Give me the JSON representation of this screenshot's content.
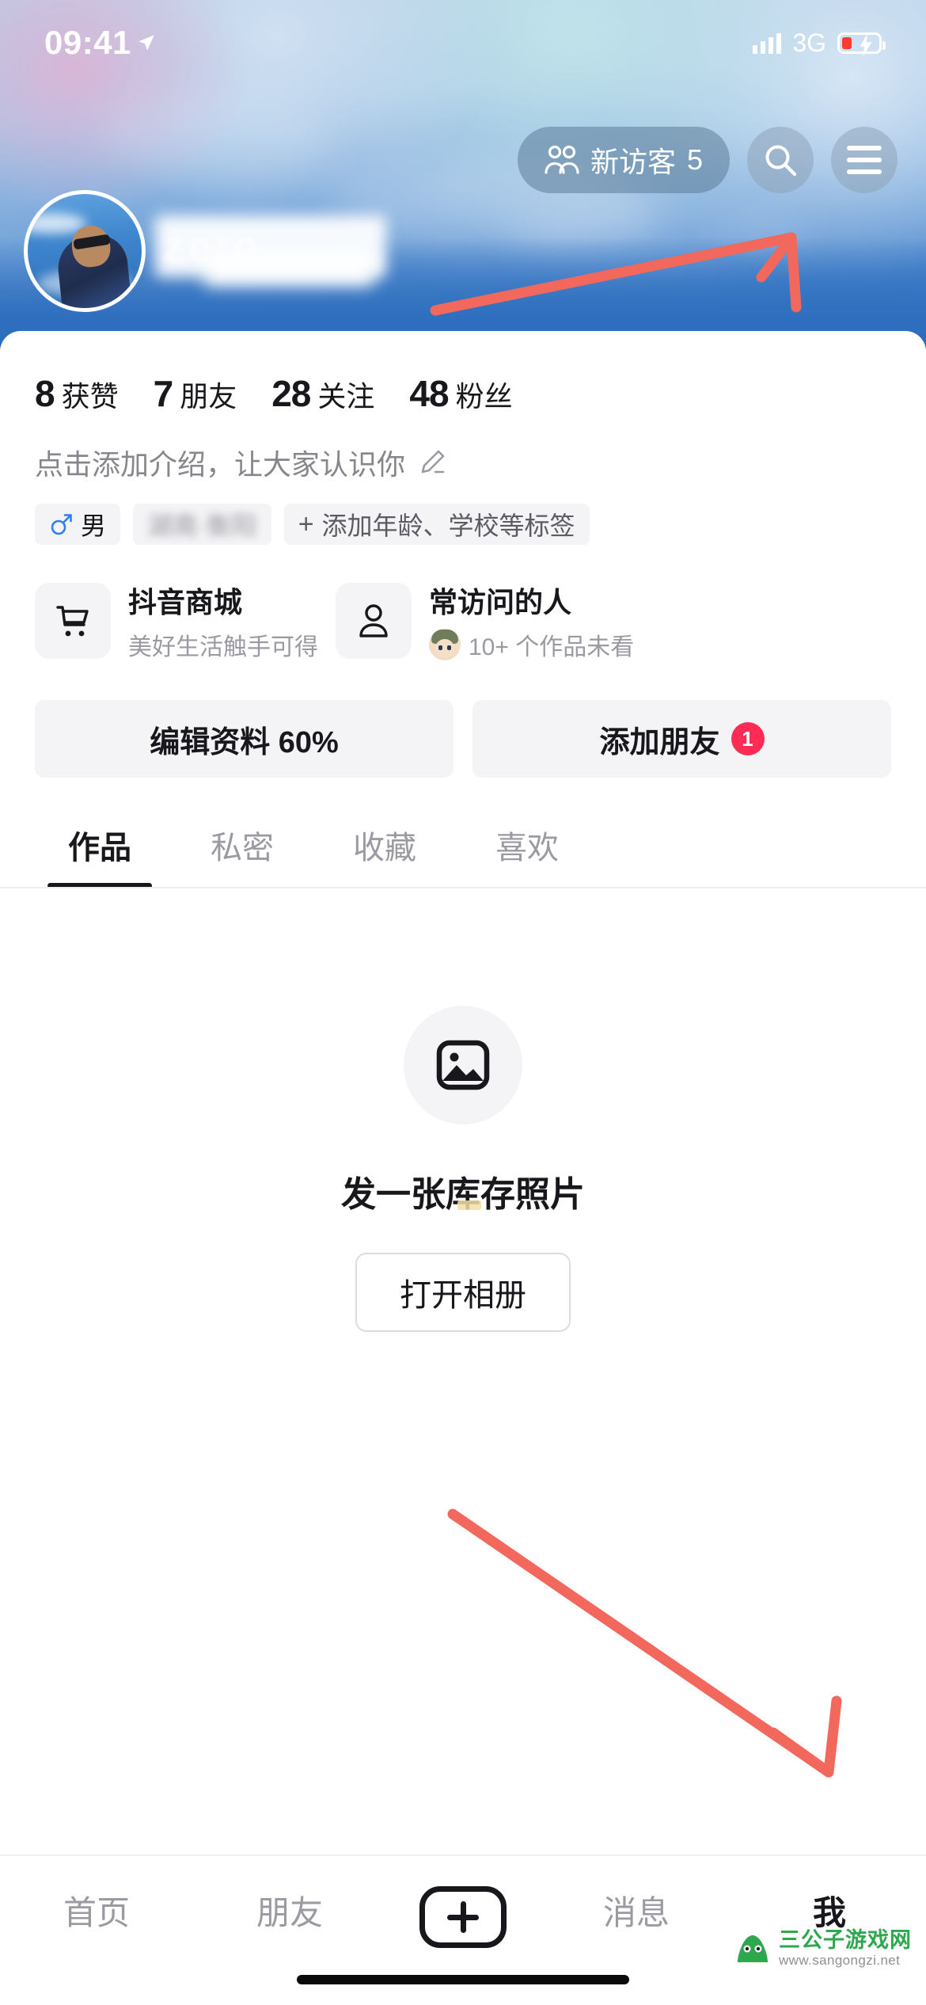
{
  "status_bar": {
    "time": "09:41",
    "network": "3G",
    "location_icon": "location-arrow-icon",
    "signal_icon": "signal-bars-icon",
    "battery_icon": "battery-charging-icon"
  },
  "header": {
    "visitors_label": "新访客",
    "visitors_count": "5",
    "visitors_icon": "two-people-icon",
    "search_icon": "search-icon",
    "menu_icon": "hamburger-menu-icon"
  },
  "profile": {
    "avatar_name": "avatar",
    "display_name_blurred": "zero"
  },
  "stats": [
    {
      "num": "8",
      "label": "获赞"
    },
    {
      "num": "7",
      "label": "朋友"
    },
    {
      "num": "28",
      "label": "关注"
    },
    {
      "num": "48",
      "label": "粉丝"
    }
  ],
  "bio": {
    "text": "点击添加介绍，让大家认识你",
    "edit_icon": "pencil-icon"
  },
  "tags": {
    "gender": "男",
    "gender_icon": "male-symbol-icon",
    "location_blurred": "湖南·衡阳",
    "add_label": "添加年龄、学校等标签",
    "add_plus": "+"
  },
  "cards": [
    {
      "title": "抖音商城",
      "subtitle": "美好生活触手可得",
      "icon": "shopping-cart-icon"
    },
    {
      "title": "常访问的人",
      "subtitle": "10+ 个作品未看",
      "icon": "person-icon"
    }
  ],
  "actions": [
    {
      "label": "编辑资料 60%",
      "badge": ""
    },
    {
      "label": "添加朋友",
      "badge": "1"
    }
  ],
  "tabs": [
    {
      "label": "作品",
      "active": true
    },
    {
      "label": "私密",
      "active": false
    },
    {
      "label": "收藏",
      "active": false
    },
    {
      "label": "喜欢",
      "active": false
    }
  ],
  "empty_state": {
    "icon": "image-placeholder-icon",
    "text": "发一张库存照片",
    "button_label": "打开相册"
  },
  "bottom_nav": [
    {
      "label": "首页",
      "active": false
    },
    {
      "label": "朋友",
      "active": false
    },
    {
      "label": "",
      "active": false,
      "icon": "plus-create-icon"
    },
    {
      "label": "消息",
      "active": false
    },
    {
      "label": "我",
      "active": true
    }
  ],
  "annotations": {
    "arrow_color": "#f2685c",
    "arrow_up_target": "hamburger-menu-icon",
    "arrow_down_target": "nav-item-me"
  },
  "watermark": {
    "title": "三公子游戏网",
    "url": "www.sangongzi.net",
    "icon": "frog-logo-icon"
  },
  "colors": {
    "accent_red": "#fe2c55",
    "text_primary": "#18181c",
    "text_muted": "#9a9aa2",
    "chip_bg": "#f4f4f6"
  }
}
